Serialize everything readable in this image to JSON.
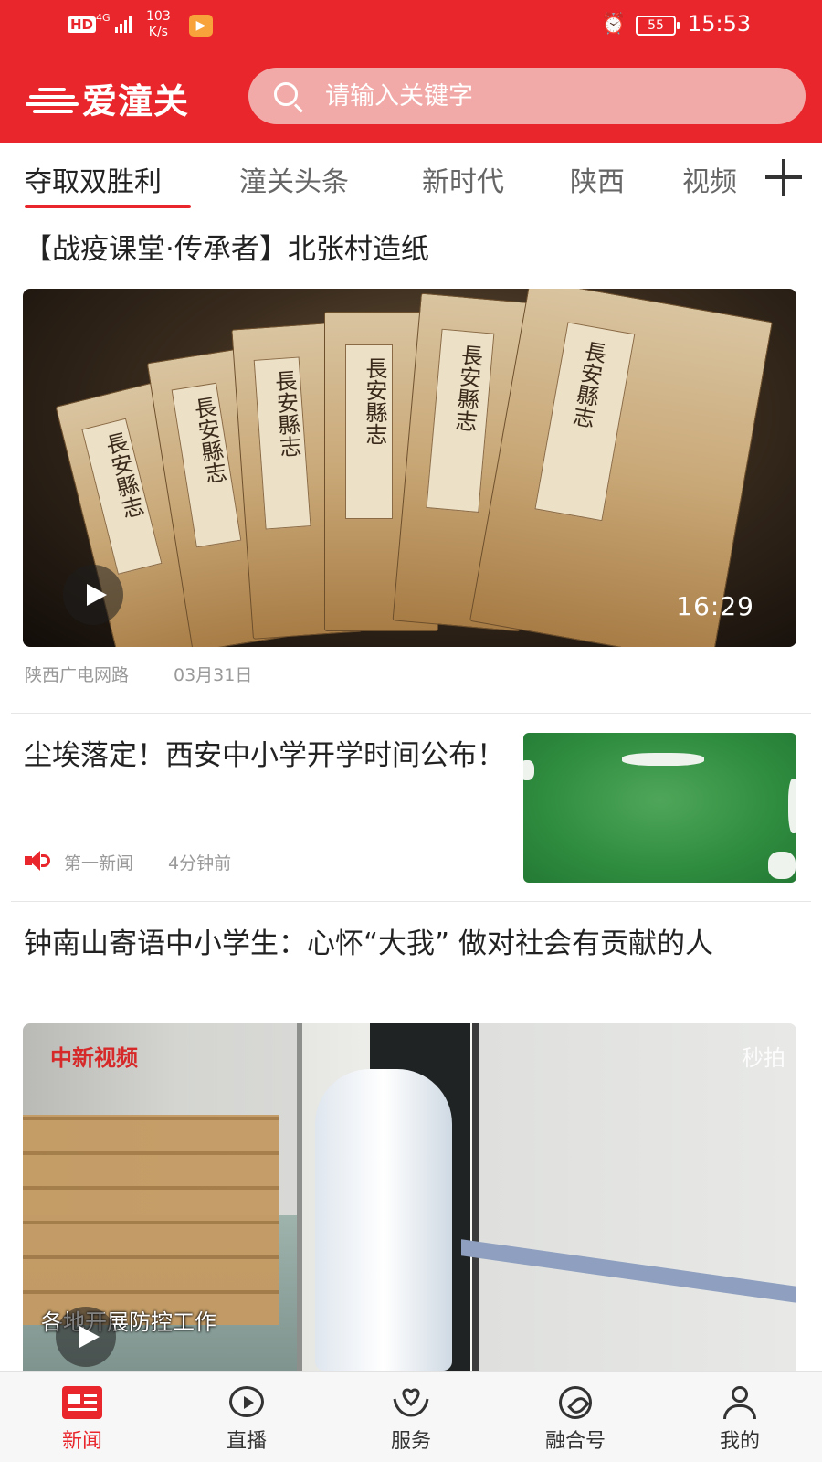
{
  "status_bar": {
    "hd": "HD",
    "network": "4G",
    "speed_value": "103",
    "speed_unit": "K/s",
    "battery": "55",
    "time": "15:53"
  },
  "header": {
    "app_name": "爱潼关",
    "search_placeholder": "请输入关键字",
    "brand_color": "#e8262b"
  },
  "tabs": [
    {
      "label": "夺取双胜利",
      "active": true
    },
    {
      "label": "潼关头条",
      "active": false
    },
    {
      "label": "新时代",
      "active": false
    },
    {
      "label": "陕西",
      "active": false
    },
    {
      "label": "视频",
      "active": false
    }
  ],
  "feed": [
    {
      "title": "【战疫课堂·传承者】北张村造纸",
      "duration": "16:29",
      "book_label": "長安縣志",
      "source": "陕西广电网路",
      "date": "03月31日"
    },
    {
      "title": "尘埃落定！西安中小学开学时间公布！",
      "source": "第一新闻",
      "time_ago": "4分钟前"
    },
    {
      "title": "钟南山寄语中小学生：心怀“大我” 做对社会有贡献的人",
      "watermark_left": "中新视频",
      "watermark_right": "秒拍",
      "caption": "各地开展防控工作"
    }
  ],
  "bottom_nav": [
    {
      "label": "新闻",
      "icon": "newspaper-icon",
      "active": true
    },
    {
      "label": "直播",
      "icon": "play-circle-icon",
      "active": false
    },
    {
      "label": "服务",
      "icon": "heart-hands-icon",
      "active": false
    },
    {
      "label": "融合号",
      "icon": "compass-icon",
      "active": false
    },
    {
      "label": "我的",
      "icon": "user-icon",
      "active": false
    }
  ]
}
